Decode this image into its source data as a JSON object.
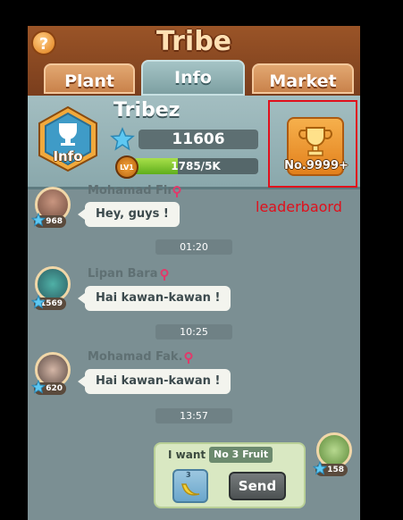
{
  "header": {
    "title": "Tribe",
    "help_icon": "?"
  },
  "tabs": [
    {
      "label": "Plant",
      "active": false
    },
    {
      "label": "Info",
      "active": true
    },
    {
      "label": "Market",
      "active": false
    }
  ],
  "tribe": {
    "badge_label": "Info",
    "name": "Tribez",
    "score": "11606",
    "level_label": "LV1",
    "xp_text": "1785/5K",
    "xp_fraction": 0.357,
    "leaderboard_rank": "No.9999+"
  },
  "annotation": {
    "label": "leaderbaord",
    "color": "#e0101c"
  },
  "messages": [
    {
      "sender": "Mohamad Fir",
      "text": "Hey, guys !",
      "stars": "968"
    },
    {
      "sender": "Lipan Bara",
      "text": "Hai kawan-kawan !",
      "stars": "1569"
    },
    {
      "sender": "Mohamad Fak.",
      "text": "Hai kawan-kawan !",
      "stars": "620"
    }
  ],
  "timestamps": [
    "01:20",
    "10:25",
    "13:57"
  ],
  "request": {
    "label": "I want",
    "item": "No 3 Fruit",
    "fruit_count": "3",
    "send_label": "Send",
    "my_stars": "158"
  }
}
